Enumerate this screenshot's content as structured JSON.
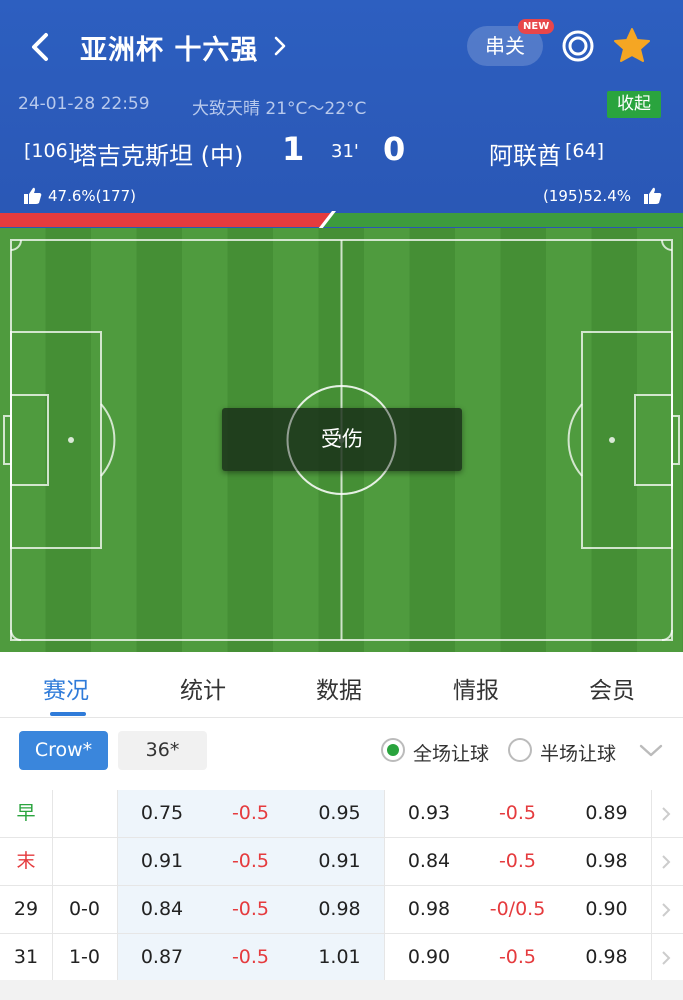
{
  "header": {
    "title": "亚洲杯 十六强",
    "parlay_label": "串关",
    "new_badge": "NEW",
    "datetime": "24-01-28 22:59",
    "weather": "大致天晴 21°C～22°C",
    "collapse_label": "收起"
  },
  "match": {
    "home_rank": "[106]",
    "home_name": "塔吉克斯坦 (中)",
    "home_score": "1",
    "minute": "31'",
    "away_score": "0",
    "away_name": "阿联酋",
    "away_rank": "[64]",
    "home_vote": "47.6%(177)",
    "away_vote": "(195)52.4%",
    "home_vote_pct": 47.6,
    "away_vote_pct": 52.4,
    "home_color": "#e53b3e",
    "away_color": "#3d9b3d"
  },
  "pitch": {
    "event_label": "受伤"
  },
  "tabs": [
    {
      "label": "赛况",
      "active": true
    },
    {
      "label": "统计",
      "active": false
    },
    {
      "label": "数据",
      "active": false
    },
    {
      "label": "情报",
      "active": false
    },
    {
      "label": "会员",
      "active": false
    }
  ],
  "filters": {
    "bookmakers": [
      "Crow*",
      "36*"
    ],
    "selected_bookmaker": "Crow*",
    "radio_full": "全场让球",
    "radio_half": "半场让球",
    "selected_radio": "全场让球"
  },
  "odds": {
    "rows": [
      {
        "label": "早",
        "score": "",
        "a": "0.75",
        "b": "-0.5",
        "c": "0.95",
        "d": "0.93",
        "e": "-0.5",
        "f": "0.89"
      },
      {
        "label": "末",
        "score": "",
        "a": "0.91",
        "b": "-0.5",
        "c": "0.91",
        "d": "0.84",
        "e": "-0.5",
        "f": "0.98"
      },
      {
        "label": "29",
        "score": "0-0",
        "a": "0.84",
        "b": "-0.5",
        "c": "0.98",
        "d": "0.98",
        "e": "-0/0.5",
        "f": "0.90"
      },
      {
        "label": "31",
        "score": "1-0",
        "a": "0.87",
        "b": "-0.5",
        "c": "1.01",
        "d": "0.90",
        "e": "-0.5",
        "f": "0.98"
      }
    ]
  },
  "colors": {
    "header_bg": "#2d5fc0",
    "accent": "#2f7bd9",
    "green": "#2aa43e",
    "red": "#e53b3e",
    "star": "#f5a623"
  },
  "icons": [
    "back-arrow-icon",
    "chevron-right-icon",
    "target-ring-icon",
    "star-icon",
    "thumbs-up-icon",
    "chevron-down-icon"
  ]
}
